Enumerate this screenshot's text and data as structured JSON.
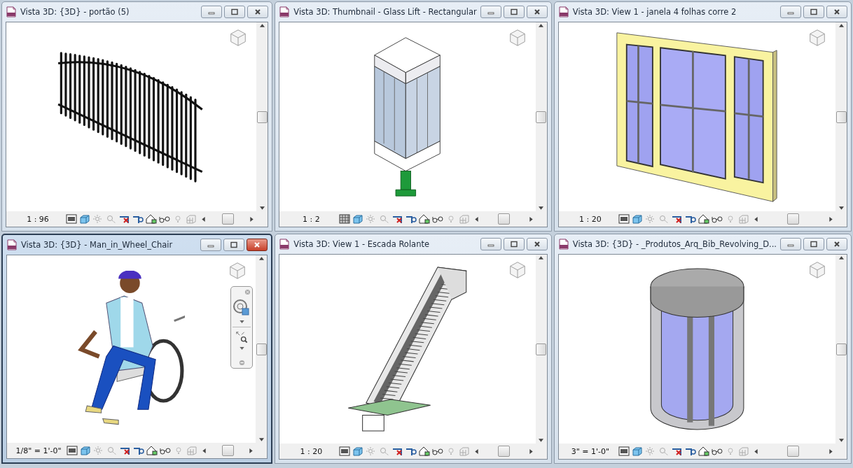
{
  "views": [
    {
      "title": "Vista 3D: {3D} - portão (5)",
      "selected": false,
      "kind": "fence",
      "scale": "1 : 96",
      "fine_detail": false
    },
    {
      "title": "Vista 3D: Thumbnail - Glass Lift - Rectangular",
      "selected": false,
      "kind": "lift",
      "scale": "1 : 2",
      "fine_detail": true
    },
    {
      "title": "Vista 3D: View 1 - janela 4 folhas corre 2",
      "selected": false,
      "kind": "window",
      "scale": "1 : 20",
      "fine_detail": false
    },
    {
      "title": "Vista 3D: {3D} - Man_in_Wheel_Chair",
      "selected": true,
      "kind": "person",
      "scale": "1/8\" = 1'-0\"",
      "fine_detail": false
    },
    {
      "title": "Vista 3D: View 1 - Escada Rolante",
      "selected": false,
      "kind": "escalator",
      "scale": "1 : 20",
      "fine_detail": false
    },
    {
      "title": "Vista 3D: {3D} - _Produtos_Arq_Bib_Revolving_D...",
      "selected": false,
      "kind": "door",
      "scale": "3\" = 1'-0\"",
      "fine_detail": false
    }
  ]
}
